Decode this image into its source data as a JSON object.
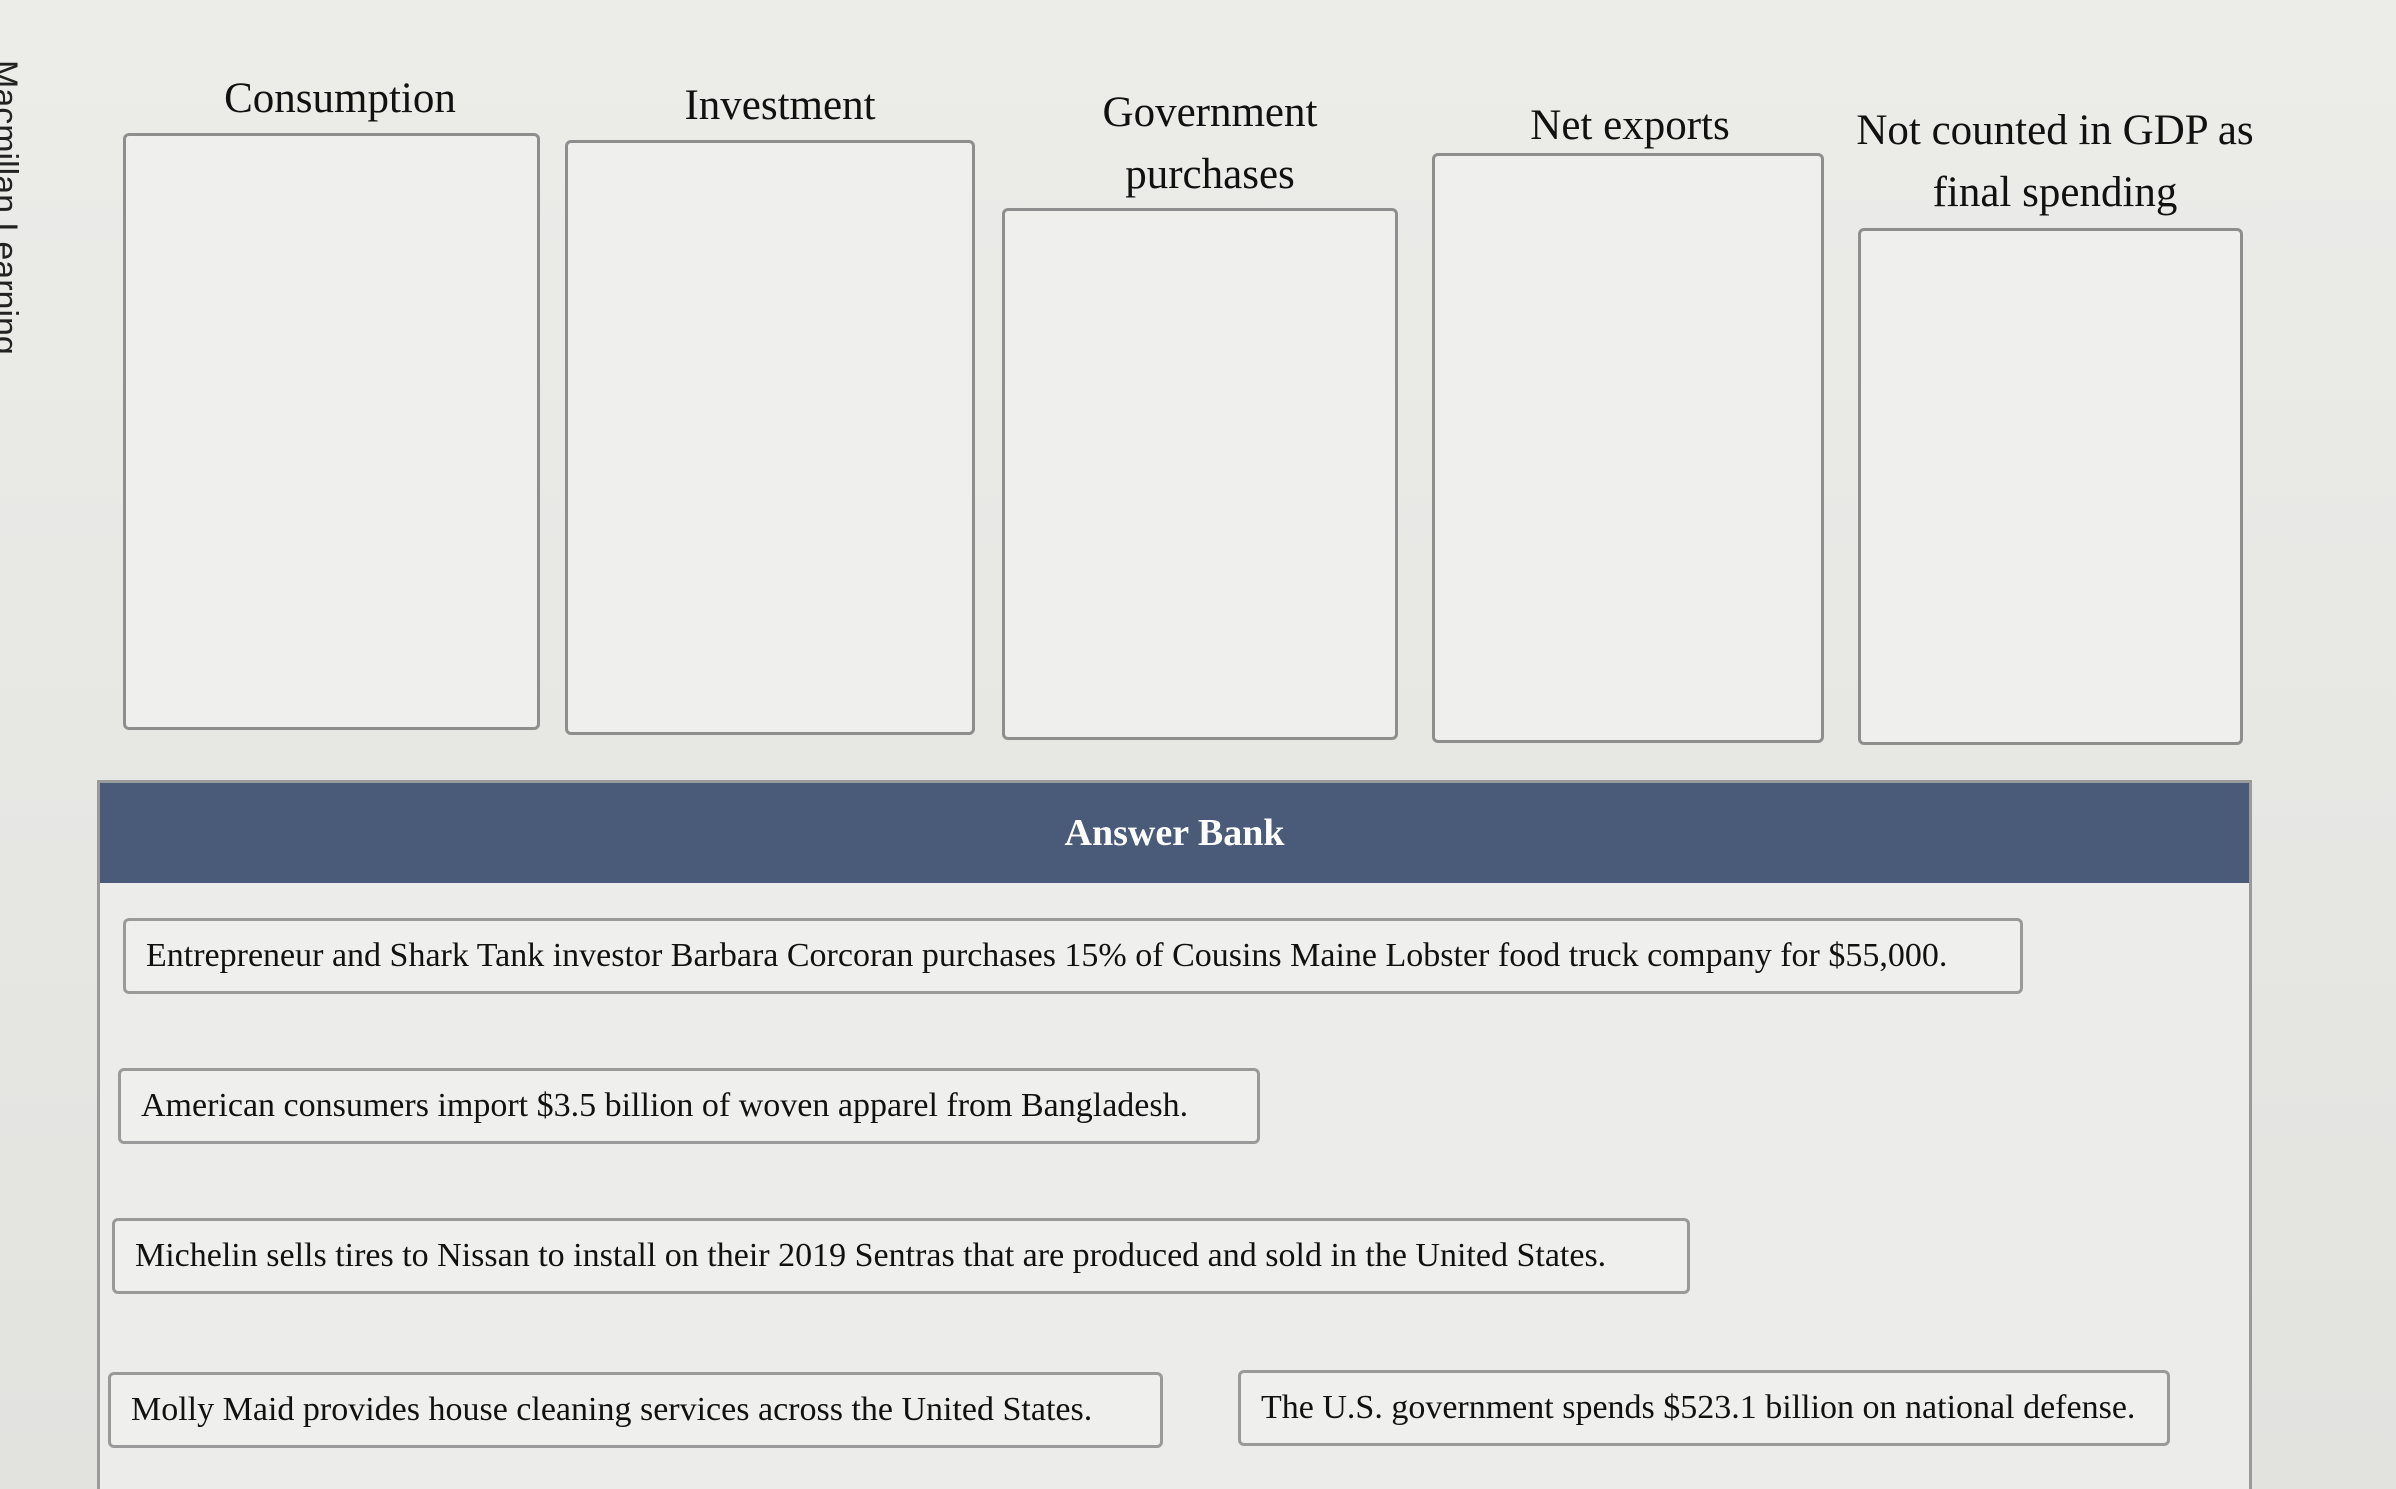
{
  "side_fragment": "Macmillan Learning",
  "categories": [
    {
      "id": "consumption",
      "label": "Consumption"
    },
    {
      "id": "investment",
      "label": "Investment"
    },
    {
      "id": "government",
      "label": "Government purchases"
    },
    {
      "id": "net_exports",
      "label": "Net exports"
    },
    {
      "id": "not_counted",
      "label": "Not counted in GDP as final spending"
    }
  ],
  "answer_bank": {
    "title": "Answer Bank",
    "items": [
      "Entrepreneur and Shark Tank investor Barbara Corcoran purchases 15% of Cousins Maine Lobster food truck company for $55,000.",
      "American consumers import $3.5 billion of woven apparel from Bangladesh.",
      "Michelin sells tires to Nissan to install on their 2019 Sentras that are produced and sold in the United States.",
      "Molly Maid provides house cleaning services across the United States.",
      "The U.S. government spends $523.1 billion on national defense."
    ]
  }
}
